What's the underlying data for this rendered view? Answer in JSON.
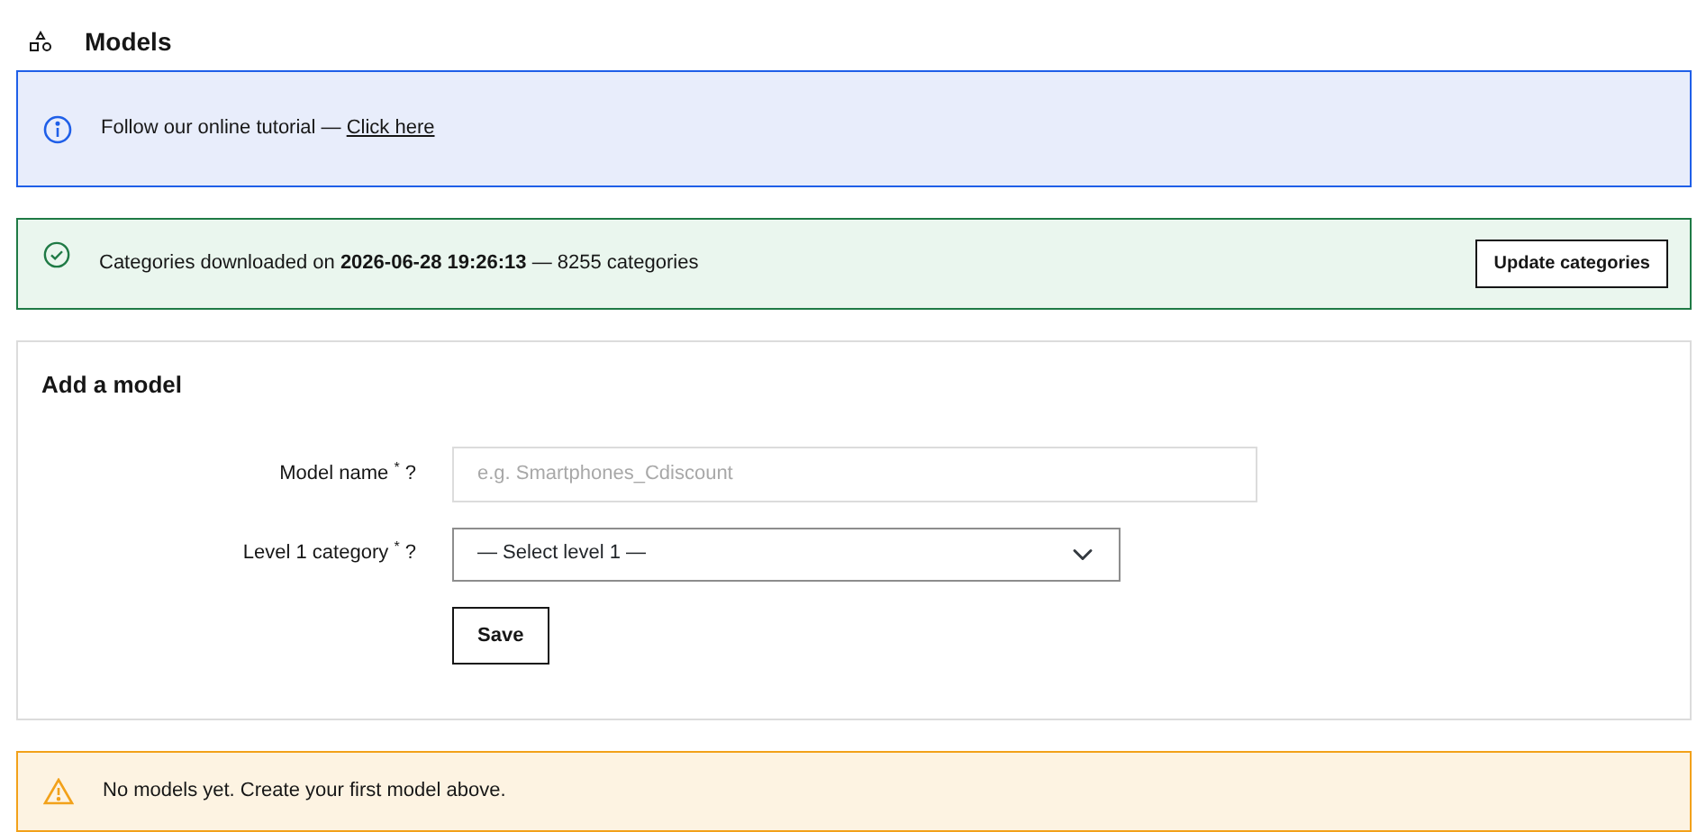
{
  "header": {
    "title": "Models"
  },
  "notices": [
    {
      "kind": "info",
      "text": "Follow our online tutorial — ",
      "link": "Click here"
    },
    {
      "kind": "success",
      "text": "Categories downloaded on **2026-06-28 19:26:13** — 8255 categories",
      "button": "Update categories"
    }
  ],
  "form": {
    "title": "Add a model",
    "fields": [
      {
        "kind": "text",
        "label": "Model name",
        "required_mark": "*",
        "help": "?",
        "placeholder": "e.g. Smartphones_Cdiscount"
      },
      {
        "kind": "select",
        "label": "Level 1 category",
        "required_mark": "*",
        "help": "?",
        "value": "— Select level 1 —"
      }
    ],
    "submit": "Save"
  },
  "empty_notice": {
    "kind": "warning",
    "text": "No models yet. Create your first model above."
  }
}
